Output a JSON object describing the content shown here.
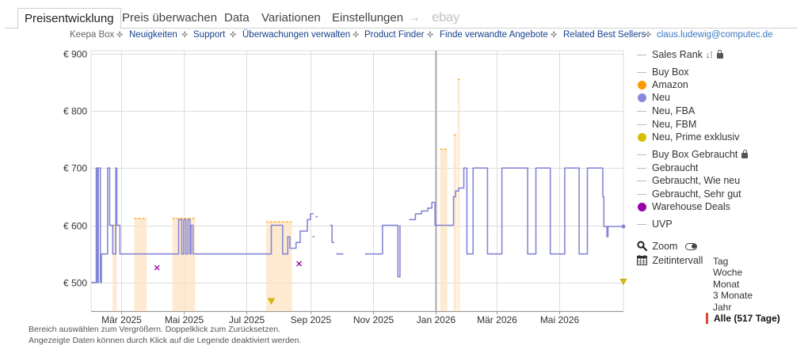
{
  "tabs": [
    {
      "label": "Preisentwicklung",
      "active": true
    },
    {
      "label": "Preis überwachen"
    },
    {
      "label": "Data"
    },
    {
      "label": "Variationen"
    },
    {
      "label": "Einstellungen"
    }
  ],
  "tab_arrow": "→",
  "tab_ebay": "ebay",
  "linkbar": {
    "prefix": "Keepa Box",
    "links": [
      "Neuigkeiten",
      "Support",
      "Überwachungen verwalten",
      "Product Finder",
      "Finde verwandte Angebote",
      "Related Best Sellers"
    ],
    "email": "claus.ludewig@computec.de",
    "separator_icon": "move-cross-icon"
  },
  "legend": [
    {
      "label": "Sales Rank",
      "marker": "line",
      "sort_icon": "sort-icon",
      "locked": true
    },
    {
      "label": "Buy Box",
      "marker": "line"
    },
    {
      "label": "Amazon",
      "marker": "dot",
      "color": "#ff9900"
    },
    {
      "label": "Neu",
      "marker": "dot",
      "color": "#8888dd"
    },
    {
      "label": "Neu, FBA",
      "marker": "line"
    },
    {
      "label": "Neu, FBM",
      "marker": "line"
    },
    {
      "label": "Neu, Prime exklusiv",
      "marker": "dot",
      "color": "#d9bd00"
    },
    {
      "label": "Buy Box Gebraucht",
      "marker": "line",
      "locked": true
    },
    {
      "label": "Gebraucht",
      "marker": "line"
    },
    {
      "label": "Gebraucht, Wie neu",
      "marker": "line"
    },
    {
      "label": "Gebraucht, Sehr gut",
      "marker": "line"
    },
    {
      "label": "Warehouse Deals",
      "marker": "dot",
      "color": "#9900aa"
    },
    {
      "label": "UVP",
      "marker": "line"
    }
  ],
  "controls": {
    "zoom_label": "Zoom",
    "zoom_icon": "magnifier-icon",
    "interval_label": "Zeitintervall",
    "interval_icon": "calendar-icon"
  },
  "ranges": [
    "Tag",
    "Woche",
    "Monat",
    "3 Monate",
    "Jahr",
    "Alle (517 Tage)"
  ],
  "selected_range": "Alle (517 Tage)",
  "notes": [
    "Bereich auswählen zum Vergrößern. Doppelklick zum Zurücksetzen.",
    "Angezeigte Daten können durch Klick auf die Legende deaktiviert werden."
  ],
  "colors": {
    "neu": "#8686d8",
    "amazon_shade": "#fde3c2",
    "prime_marker": "#d9bd00",
    "warehouse": "#9900aa",
    "grid": "#dddddd",
    "today_line": "#aaaaaa"
  },
  "chart_data": {
    "type": "line",
    "title": "",
    "xlabel": "",
    "ylabel": "",
    "y_ticks": [
      "€ 500",
      "€ 600",
      "€ 700",
      "€ 800",
      "€ 900"
    ],
    "y_tick_values": [
      500,
      600,
      700,
      800,
      900
    ],
    "ylim": [
      450,
      905
    ],
    "x_ticks": [
      "Mär 2025",
      "Mai 2025",
      "Jul 2025",
      "Sep 2025",
      "Nov 2025",
      "Jan 2026",
      "Mär 2026",
      "Mai 2026"
    ],
    "x_tick_values": [
      "2025-03-01",
      "2025-05-01",
      "2025-07-01",
      "2025-09-01",
      "2025-11-01",
      "2026-01-01",
      "2026-03-01",
      "2026-05-01"
    ],
    "xlim": [
      "2025-01-31",
      "2026-07-02"
    ],
    "grid": true,
    "today": "2026-01-01",
    "series": [
      {
        "name": "Neu",
        "points": [
          [
            "2025-01-31",
            500
          ],
          [
            "2025-02-05",
            500
          ],
          [
            "2025-02-05",
            700
          ],
          [
            "2025-02-06",
            700
          ],
          [
            "2025-02-06",
            500
          ],
          [
            "2025-02-07",
            500
          ],
          [
            "2025-02-07",
            700
          ],
          [
            "2025-02-09",
            700
          ],
          [
            "2025-02-09",
            500
          ],
          [
            "2025-02-10",
            500
          ],
          [
            "2025-02-10",
            550
          ],
          [
            "2025-02-16",
            550
          ],
          [
            "2025-02-16",
            700
          ],
          [
            "2025-02-18",
            700
          ],
          [
            "2025-02-18",
            600
          ],
          [
            "2025-02-21",
            600
          ],
          [
            "2025-02-21",
            550
          ],
          [
            "2025-02-24",
            550
          ],
          [
            "2025-02-24",
            700
          ],
          [
            "2025-02-25",
            700
          ],
          [
            "2025-02-25",
            600
          ],
          [
            "2025-02-28",
            600
          ],
          [
            "2025-02-28",
            550
          ],
          [
            "2025-04-26",
            550
          ],
          [
            "2025-04-26",
            610
          ],
          [
            "2025-04-29",
            610
          ],
          [
            "2025-04-29",
            550
          ],
          [
            "2025-05-01",
            550
          ],
          [
            "2025-05-01",
            610
          ],
          [
            "2025-05-03",
            610
          ],
          [
            "2025-05-03",
            550
          ],
          [
            "2025-05-05",
            550
          ],
          [
            "2025-05-05",
            610
          ],
          [
            "2025-05-07",
            610
          ],
          [
            "2025-05-07",
            550
          ],
          [
            "2025-05-08",
            550
          ],
          [
            "2025-05-08",
            600
          ],
          [
            "2025-05-10",
            600
          ],
          [
            "2025-05-10",
            550
          ],
          [
            "2025-07-25",
            550
          ],
          [
            "2025-07-25",
            600
          ],
          [
            "2025-08-05",
            600
          ],
          [
            "2025-08-05",
            550
          ],
          [
            "2025-08-10",
            550
          ],
          [
            "2025-08-10",
            580
          ],
          [
            "2025-08-12",
            580
          ],
          [
            "2025-08-12",
            560
          ],
          [
            "2025-08-18",
            560
          ],
          [
            "2025-08-18",
            570
          ],
          [
            "2025-08-22",
            570
          ],
          [
            "2025-08-22",
            590
          ],
          [
            "2025-08-29",
            590
          ],
          [
            "2025-08-29",
            610
          ],
          [
            "2025-09-01",
            610
          ],
          [
            "2025-09-01",
            620
          ],
          [
            "2025-09-04",
            620
          ],
          null,
          [
            "2025-09-03",
            580
          ],
          [
            "2025-09-05",
            580
          ],
          null,
          [
            "2025-09-06",
            615
          ],
          [
            "2025-09-08",
            615
          ],
          null,
          [
            "2025-09-20",
            600
          ],
          [
            "2025-09-22",
            600
          ],
          [
            "2025-09-22",
            570
          ],
          [
            "2025-09-24",
            570
          ],
          null,
          [
            "2025-09-26",
            550
          ],
          [
            "2025-10-03",
            550
          ],
          null,
          [
            "2025-10-24",
            550
          ],
          [
            "2025-11-10",
            550
          ],
          [
            "2025-11-10",
            600
          ],
          [
            "2025-11-25",
            600
          ],
          [
            "2025-11-25",
            510
          ],
          [
            "2025-11-27",
            510
          ],
          [
            "2025-11-27",
            600
          ],
          null,
          [
            "2025-12-06",
            610
          ],
          [
            "2025-12-12",
            610
          ],
          [
            "2025-12-12",
            620
          ],
          [
            "2025-12-18",
            620
          ],
          [
            "2025-12-18",
            625
          ],
          [
            "2025-12-24",
            625
          ],
          [
            "2025-12-24",
            630
          ],
          [
            "2025-12-28",
            630
          ],
          [
            "2025-12-28",
            640
          ],
          [
            "2025-12-31",
            640
          ],
          [
            "2025-12-31",
            600
          ],
          [
            "2026-01-18",
            600
          ],
          [
            "2026-01-18",
            650
          ],
          [
            "2026-01-20",
            650
          ],
          [
            "2026-01-20",
            660
          ],
          [
            "2026-01-23",
            660
          ],
          [
            "2026-01-23",
            665
          ],
          [
            "2026-01-28",
            665
          ],
          [
            "2026-01-28",
            700
          ],
          [
            "2026-01-31",
            700
          ],
          [
            "2026-01-31",
            550
          ],
          [
            "2026-02-06",
            550
          ],
          [
            "2026-02-06",
            700
          ],
          [
            "2026-02-20",
            700
          ],
          [
            "2026-02-20",
            550
          ],
          [
            "2026-03-06",
            550
          ],
          [
            "2026-03-06",
            700
          ],
          [
            "2026-03-31",
            700
          ],
          [
            "2026-03-31",
            550
          ],
          [
            "2026-04-08",
            550
          ],
          [
            "2026-04-08",
            700
          ],
          [
            "2026-04-22",
            700
          ],
          [
            "2026-04-22",
            550
          ],
          [
            "2026-05-06",
            550
          ],
          [
            "2026-05-06",
            700
          ],
          [
            "2026-05-20",
            700
          ],
          [
            "2026-05-20",
            550
          ],
          [
            "2026-05-28",
            550
          ],
          [
            "2026-05-28",
            700
          ],
          [
            "2026-06-12",
            700
          ],
          [
            "2026-06-12",
            650
          ],
          [
            "2026-06-13",
            650
          ],
          [
            "2026-06-13",
            598
          ],
          [
            "2026-06-16",
            598
          ],
          [
            "2026-06-16",
            580
          ],
          [
            "2026-06-17",
            580
          ],
          [
            "2026-06-17",
            598
          ],
          [
            "2026-07-02",
            598
          ]
        ]
      },
      {
        "name": "Amazon",
        "bands": [
          {
            "from": "2025-02-21",
            "to": "2025-02-25",
            "price": 600
          },
          {
            "from": "2025-03-14",
            "to": "2025-03-26",
            "price": 612
          },
          {
            "from": "2025-04-20",
            "to": "2025-05-12",
            "price": 612
          },
          {
            "from": "2025-07-20",
            "to": "2025-08-14",
            "price": 606
          },
          {
            "from": "2026-01-05",
            "to": "2026-01-12",
            "price": 733
          },
          {
            "from": "2026-01-18",
            "to": "2026-01-21",
            "price": 758
          },
          {
            "from": "2026-01-22",
            "to": "2026-01-24",
            "price": 855
          }
        ]
      },
      {
        "name": "Neu, Prime exklusiv",
        "points": [
          [
            "2025-07-25",
            468
          ],
          [
            "2026-07-02",
            502
          ]
        ]
      },
      {
        "name": "Warehouse Deals",
        "points": [
          [
            "2025-04-05",
            526
          ],
          [
            "2025-08-21",
            533
          ]
        ]
      }
    ]
  }
}
